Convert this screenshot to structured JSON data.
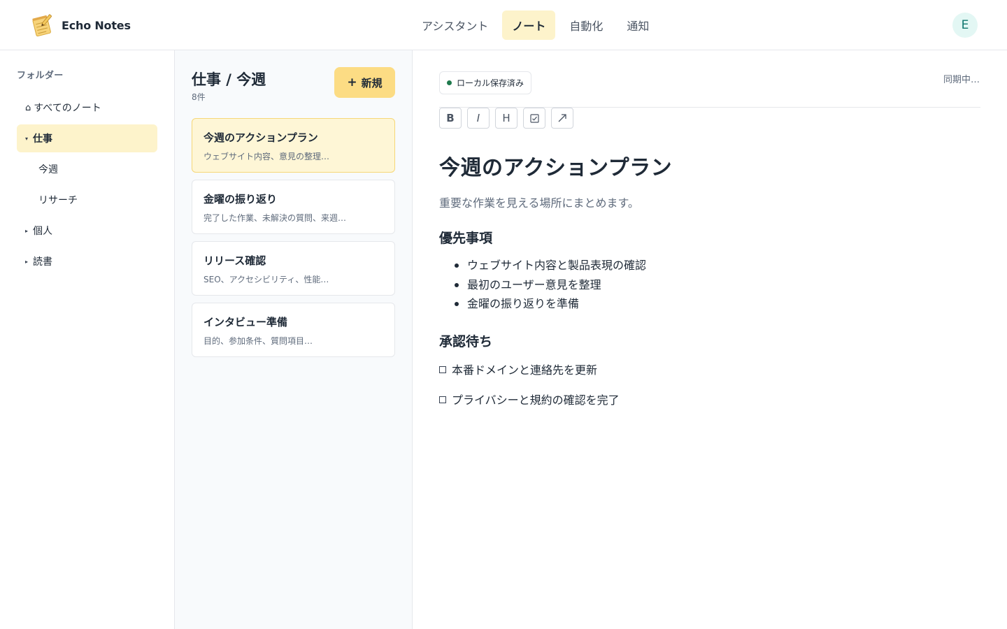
{
  "app": {
    "name": "Echo Notes",
    "avatar_initial": "E"
  },
  "nav": {
    "tabs": [
      {
        "label": "アシスタント"
      },
      {
        "label": "ノート",
        "active": true
      },
      {
        "label": "自動化"
      },
      {
        "label": "通知"
      }
    ]
  },
  "sidebar": {
    "heading": "フォルダー",
    "items": [
      {
        "glyph": "⌂",
        "label": "すべてのノート"
      },
      {
        "glyph": "▾",
        "label": "仕事",
        "active": true
      },
      {
        "glyph": "",
        "label": "今週"
      },
      {
        "glyph": "",
        "label": "リサーチ"
      },
      {
        "glyph": "▸",
        "label": "個人"
      },
      {
        "glyph": "▸",
        "label": "読書"
      }
    ]
  },
  "notelist": {
    "title": "仕事 / 今週",
    "count": "8件",
    "new_button": {
      "icon": "+",
      "label": "新規"
    },
    "notes": [
      {
        "title": "今週のアクションプラン",
        "snippet": "ウェブサイト内容、意見の整理…",
        "active": true
      },
      {
        "title": "金曜の振り返り",
        "snippet": "完了した作業、未解決の質問、来週…"
      },
      {
        "title": "リリース確認",
        "snippet": "SEO、アクセシビリティ、性能…"
      },
      {
        "title": "インタビュー準備",
        "snippet": "目的、参加条件、質問項目…"
      }
    ]
  },
  "editor": {
    "save_badge": "ローカル保存済み",
    "sync_status": "同期中…",
    "toolbar": {
      "bold": "B",
      "italic": "I",
      "heading": "H"
    },
    "document": {
      "title": "今週のアクションプラン",
      "lead": "重要な作業を見える場所にまとめます。",
      "section1": {
        "heading": "優先事項",
        "bullets": [
          "ウェブサイト内容と製品表現の確認",
          "最初のユーザー意見を整理",
          "金曜の振り返りを準備"
        ]
      },
      "section2": {
        "heading": "承認待ち",
        "todos": [
          "本番ドメインと連絡先を更新",
          "プライバシーと規約の確認を完了"
        ]
      }
    }
  },
  "colors": {
    "accent": "#fcdc84",
    "active_bg": "#fdf3cb",
    "saved_dot": "#1f7a4d",
    "avatar_bg": "#e3f7f4",
    "avatar_fg": "#0f766e"
  }
}
